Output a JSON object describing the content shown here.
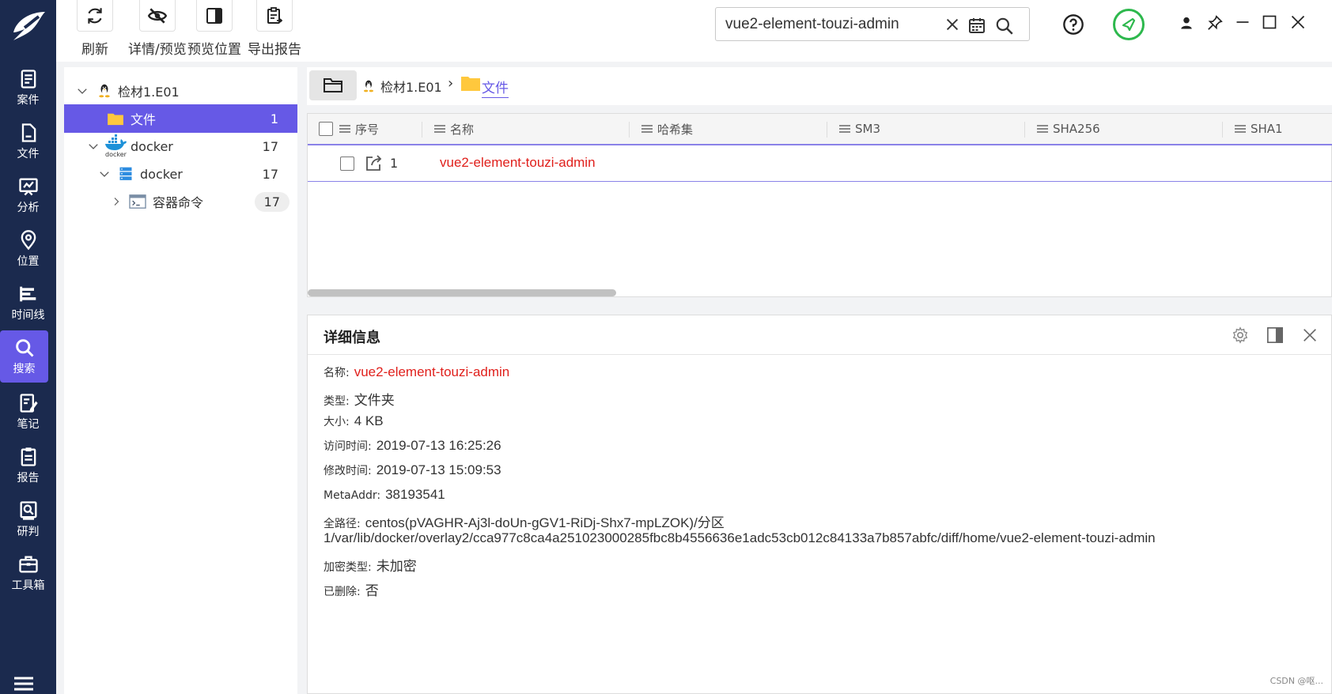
{
  "toolbar": {
    "refresh": "刷新",
    "details_preview": "详情/预览",
    "preview_position": "预览位置",
    "export_report": "导出报告"
  },
  "search": {
    "value": "vue2-element-touzi-admin"
  },
  "sidebar": {
    "items": [
      {
        "label": "案件",
        "icon": "case-icon"
      },
      {
        "label": "文件",
        "icon": "file-icon"
      },
      {
        "label": "分析",
        "icon": "analysis-icon"
      },
      {
        "label": "位置",
        "icon": "location-icon"
      },
      {
        "label": "时间线",
        "icon": "timeline-icon"
      },
      {
        "label": "搜索",
        "icon": "search-icon"
      },
      {
        "label": "笔记",
        "icon": "note-icon"
      },
      {
        "label": "报告",
        "icon": "report-icon"
      },
      {
        "label": "研判",
        "icon": "judge-icon"
      },
      {
        "label": "工具箱",
        "icon": "toolbox-icon"
      }
    ]
  },
  "tree": {
    "root": "检材1.E01",
    "files": {
      "label": "文件",
      "count": "1"
    },
    "docker1": {
      "label": "docker",
      "count": "17"
    },
    "docker2": {
      "label": "docker",
      "count": "17"
    },
    "container": {
      "label": "容器命令",
      "count": "17"
    },
    "docker_logo_text": "docker"
  },
  "breadcrumb": {
    "root": "检材1.E01",
    "sep": "›",
    "current": "文件"
  },
  "table": {
    "columns": [
      "序号",
      "名称",
      "哈希集",
      "SM3",
      "SHA256",
      "SHA1"
    ],
    "rows": [
      {
        "index": "1",
        "name": "vue2-element-touzi-admin"
      }
    ]
  },
  "detail": {
    "title": "详细信息",
    "name_label": "名称:",
    "name": "vue2-element-touzi-admin",
    "type_label": "类型:",
    "type": "文件夹",
    "size_label": "大小:",
    "size": "4 KB",
    "atime_label": "访问时间:",
    "atime": "2019-07-13 16:25:26",
    "mtime_label": "修改时间:",
    "mtime": "2019-07-13 15:09:53",
    "meta_label": "MetaAddr:",
    "meta": "38193541",
    "path_label": "全路径:",
    "path_line1": "centos(pVAGHR-Aj3l-doUn-gGV1-RiDj-Shx7-mpLZOK)/分区",
    "path_line2": "1/var/lib/docker/overlay2/cca977c8ca4a251023000285fbc8b4556636e1adc53cb012c84133a7b857abfc/diff/home/vue2-element-touzi-admin",
    "enc_label": "加密类型:",
    "enc": "未加密",
    "del_label": "已删除:",
    "del": "否"
  },
  "watermark": "CSDN @呕...",
  "colors": {
    "accent": "#6659e6",
    "sidebar": "#1b2a4e",
    "red": "#e0201c",
    "green": "#2db84d"
  }
}
